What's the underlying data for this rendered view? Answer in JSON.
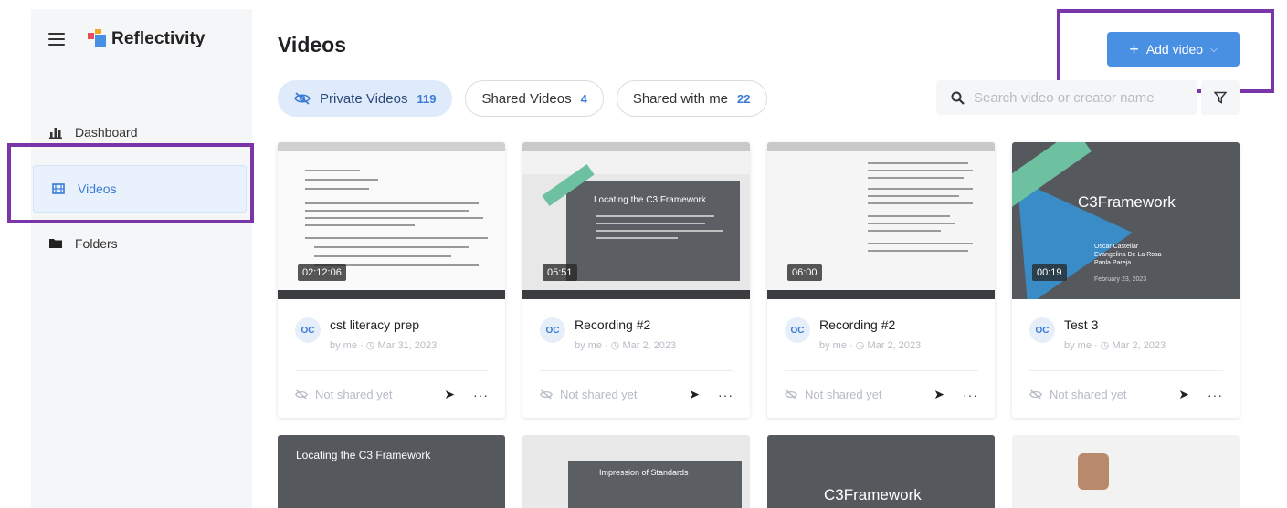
{
  "app": {
    "logo_text": "Reflectivity"
  },
  "sidebar": {
    "items": [
      {
        "label": "Dashboard",
        "icon": "bar-chart-icon"
      },
      {
        "label": "Videos",
        "icon": "film-icon"
      },
      {
        "label": "Folders",
        "icon": "folder-icon"
      }
    ]
  },
  "header": {
    "title": "Videos",
    "add_button_label": "Add video"
  },
  "tabs": [
    {
      "label": "Private Videos",
      "count": "119"
    },
    {
      "label": "Shared Videos",
      "count": "4"
    },
    {
      "label": "Shared with me",
      "count": "22"
    }
  ],
  "search": {
    "placeholder": "Search video or creator name"
  },
  "cards": [
    {
      "duration": "02:12:06",
      "avatar": "OC",
      "title": "cst literacy prep",
      "owner": "by me",
      "date": "Mar 31, 2023",
      "share_status": "Not shared yet"
    },
    {
      "duration": "05:51",
      "avatar": "OC",
      "title": "Recording #2",
      "owner": "by me",
      "date": "Mar 2, 2023",
      "share_status": "Not shared yet",
      "slide_title": "Locating the C3 Framework"
    },
    {
      "duration": "06:00",
      "avatar": "OC",
      "title": "Recording #2",
      "owner": "by me",
      "date": "Mar 2, 2023",
      "share_status": "Not shared yet"
    },
    {
      "duration": "00:19",
      "avatar": "OC",
      "title": "Test 3",
      "owner": "by me",
      "date": "Mar 2, 2023",
      "share_status": "Not shared yet",
      "slide_title": "C3Framework",
      "presenters": [
        "Oscar Castellar",
        "Evangelina De La Rosa",
        "Paola Pareja"
      ],
      "slide_date": "February 23, 2023"
    }
  ],
  "row2": [
    {
      "slide_title": "Locating the C3 Framework"
    },
    {
      "slide_title": "Impression of Standards"
    },
    {
      "slide_title": "C3Framework"
    },
    {
      "slide_title": ""
    }
  ],
  "colors": {
    "accent": "#4a90e2",
    "highlight": "#7a35a8",
    "sidebar_bg": "#f5f6f8"
  }
}
